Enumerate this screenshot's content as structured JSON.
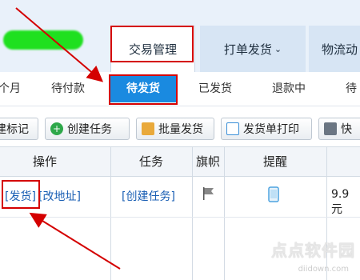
{
  "main_tabs": [
    {
      "label": "交易管理"
    },
    {
      "label": "打单发货"
    },
    {
      "label": "物流动"
    }
  ],
  "sub_tabs": [
    {
      "label": "个月"
    },
    {
      "label": "待付款"
    },
    {
      "label": "待发货"
    },
    {
      "label": "已发货"
    },
    {
      "label": "退款中"
    },
    {
      "label": "待"
    }
  ],
  "toolbar": [
    {
      "label": "建标记"
    },
    {
      "label": "创建任务"
    },
    {
      "label": "批量发货"
    },
    {
      "label": "发货单打印"
    },
    {
      "label": "快"
    }
  ],
  "table": {
    "headers": [
      "操作",
      "任务",
      "旗帜",
      "提醒"
    ],
    "row": {
      "ship_link": "[发货]",
      "address_link": "[改地址]",
      "task_link": "[创建任务]",
      "price": "9.9元"
    }
  },
  "watermark": {
    "text": "点点软件园",
    "url": "diidown.com"
  },
  "colors": {
    "accent": "#1a8ae0",
    "annotation": "#d40000",
    "nav_bg": "#e9f1fa"
  }
}
